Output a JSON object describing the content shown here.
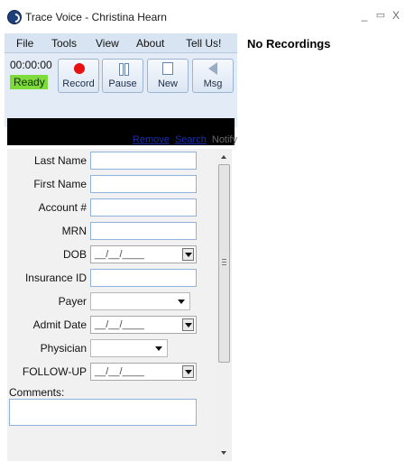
{
  "window": {
    "title": "Trace Voice - Christina Hearn",
    "controls": {
      "minimize": "_",
      "maximize": "▭",
      "close": "X"
    }
  },
  "menu": [
    "File",
    "Tools",
    "View",
    "About",
    "Tell Us!"
  ],
  "recorder": {
    "timer": "00:00:00",
    "status": "Ready",
    "buttons": {
      "record": "Record",
      "pause": "Pause",
      "new": "New",
      "msg": "Msg"
    }
  },
  "links": {
    "remove": "Remove",
    "search": "Search",
    "notify": "Notify"
  },
  "form": {
    "last_name": "Last Name",
    "first_name": "First Name",
    "account": "Account #",
    "mrn": "MRN",
    "dob": "DOB",
    "dob_value": "__/__/____",
    "insurance_id": "Insurance ID",
    "payer": "Payer",
    "admit_date": "Admit Date",
    "admit_date_value": "__/__/____",
    "physician": "Physician",
    "follow_up": "FOLLOW-UP",
    "follow_up_value": "__/__/____",
    "comments": "Comments:"
  },
  "recordings": {
    "empty_text": "No Recordings"
  },
  "colors": {
    "status_ready": "#7ddc3a",
    "record_dot": "#e81010",
    "menubar": "#d8e4f2",
    "link": "#1a2fb0"
  },
  "icons": [
    "app-logo-icon",
    "record-icon",
    "pause-icon",
    "new-document-icon",
    "speaker-icon"
  ]
}
